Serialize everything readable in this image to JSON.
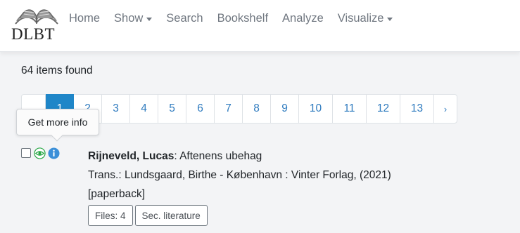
{
  "navbar": {
    "logo_text": "DLBT",
    "items": [
      {
        "label": "Home",
        "dropdown": false
      },
      {
        "label": "Show",
        "dropdown": true
      },
      {
        "label": "Search",
        "dropdown": false
      },
      {
        "label": "Bookshelf",
        "dropdown": false
      },
      {
        "label": "Analyze",
        "dropdown": false
      },
      {
        "label": "Visualize",
        "dropdown": true
      }
    ]
  },
  "results": {
    "count_text": "64 items found"
  },
  "pagination": {
    "first_label": "",
    "pages": [
      "1",
      "2",
      "3",
      "4",
      "5",
      "6",
      "7",
      "8",
      "9",
      "10",
      "11",
      "12",
      "13"
    ],
    "active_page": "1",
    "next_label": "›"
  },
  "tooltip": {
    "text": "Get more info"
  },
  "entry": {
    "author": "Rijneveld, Lucas",
    "separator": ": ",
    "title": "Aftenens ubehag",
    "line2": "Trans.: Lundsgaard, Birthe - København : Vinter Forlag, (2021)",
    "line3": "[paperback]",
    "files_label": "Files: 4",
    "sec_label": "Sec. literature"
  },
  "icons": {
    "view": "eye-icon",
    "info": "info-icon",
    "logo": "open-book-icon"
  },
  "colors": {
    "accent": "#1f86c8",
    "link": "#2f7bbf",
    "eye": "#28a745",
    "info": "#3b8fd8"
  }
}
